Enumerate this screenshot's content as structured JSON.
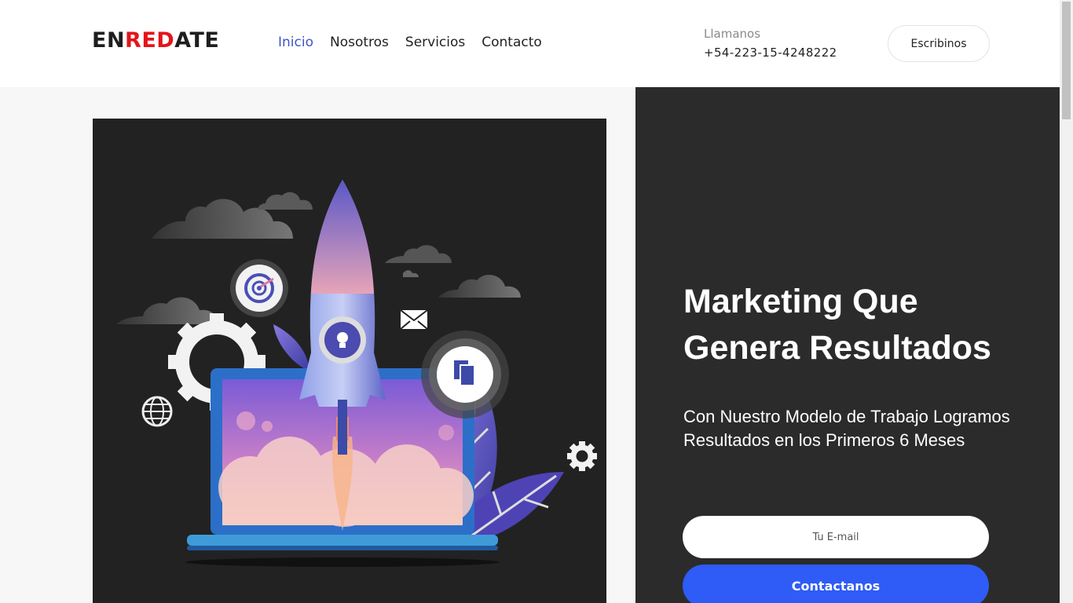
{
  "logo": {
    "part1": "EN",
    "part2": "RED",
    "part3": "ATE"
  },
  "nav": [
    {
      "label": "Inicio",
      "active": true
    },
    {
      "label": "Nosotros",
      "active": false
    },
    {
      "label": "Servicios",
      "active": false
    },
    {
      "label": "Contacto",
      "active": false
    }
  ],
  "call": {
    "label": "Llamanos",
    "phone": "+54-223-15-4248222"
  },
  "header_button": "Escribinos",
  "hero": {
    "headline": "Marketing Que Genera Resultados",
    "subheadline": "Con Nuestro Modelo de Trabajo Logramos Resultados en los Primeros 6 Meses",
    "email_placeholder": "Tu E-mail",
    "cta_label": "Contactanos"
  },
  "illustration": {
    "icons": [
      "rocket-icon",
      "laptop-icon",
      "target-icon",
      "gear-icon",
      "envelope-icon",
      "document-icon",
      "globe-icon",
      "cloud-icon",
      "leaf-icon",
      "lightbulb-icon"
    ]
  },
  "colors": {
    "accent": "#2f5bf6",
    "nav_active": "#3b55c8",
    "logo_red": "#e3151b",
    "panel_bg": "#2b2b2b",
    "image_bg": "#222222"
  }
}
